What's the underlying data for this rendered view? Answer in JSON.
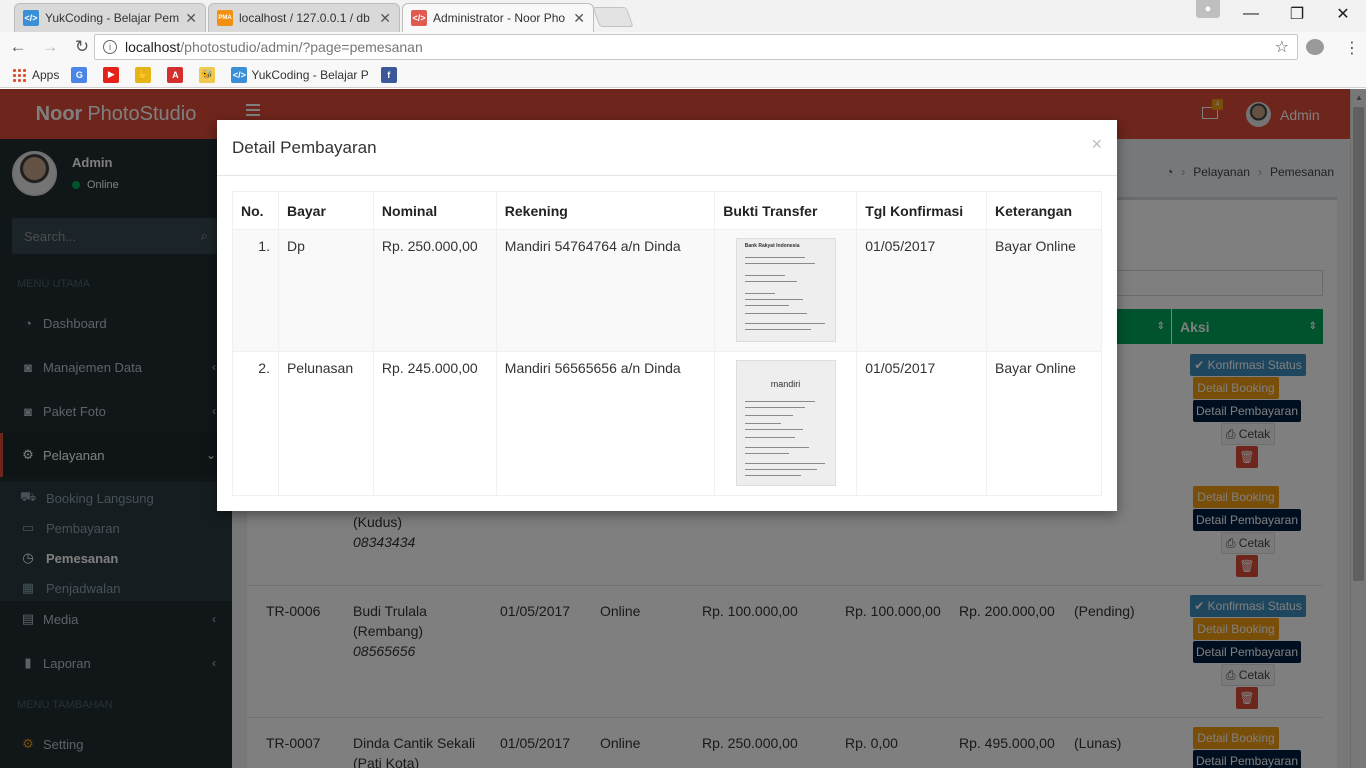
{
  "browser": {
    "tabs": [
      {
        "title": "YukCoding - Belajar Pem",
        "favicon_color": "#3a8fd6",
        "favicon_label": "</>"
      },
      {
        "title": "localhost / 127.0.0.1 / db",
        "favicon_color": "#f29111",
        "favicon_label": "PMA"
      },
      {
        "title": "Administrator - Noor Pho",
        "favicon_color": "#e05a4f",
        "favicon_label": "</>"
      }
    ],
    "url_host": "localhost",
    "url_path": "/photostudio/admin/?page=pemesanan",
    "bookmarks": {
      "apps": "Apps",
      "yukcoding": "YukCoding - Belajar P"
    }
  },
  "app": {
    "logo_bold": "Noor",
    "logo_rest": "PhotoStudio",
    "user_name": "Admin",
    "user_status": "Online",
    "search_placeholder": "Search...",
    "menu_header_main": "MENU UTAMA",
    "menu_header_extra": "MENU TAMBAHAN",
    "menu": {
      "dashboard": "Dashboard",
      "manajemen_data": "Manajemen Data",
      "paket_foto": "Paket Foto",
      "pelayanan": "Pelayanan",
      "media": "Media",
      "laporan": "Laporan",
      "setting": "Setting"
    },
    "submenu": {
      "booking_langsung": "Booking Langsung",
      "pembayaran": "Pembayaran",
      "pemesanan": "Pemesanan",
      "penjadwalan": "Penjadwalan"
    },
    "nav_user": "Admin",
    "mail_count": "4",
    "breadcrumb": {
      "level1": "Pelayanan",
      "level2": "Pemesanan"
    },
    "table": {
      "header_aksi": "Aksi",
      "rows": [
        {
          "kode": "",
          "nama": "(Kudus)",
          "telp": "08343434",
          "tgl": "",
          "jenis": "",
          "dp": "",
          "sisa": "",
          "total": "",
          "status": ""
        },
        {
          "kode": "TR-0006",
          "nama": "Budi Trulala",
          "kota": "(Rembang)",
          "telp": "08565656",
          "tgl": "01/05/2017",
          "jenis": "Online",
          "dp": "Rp. 100.000,00",
          "sisa": "Rp. 100.000,00",
          "total": "Rp. 200.000,00",
          "status": "(Pending)"
        },
        {
          "kode": "TR-0007",
          "nama": "Dinda Cantik Sekali",
          "kota": "(Pati Kota)",
          "tgl": "01/05/2017",
          "jenis": "Online",
          "dp": "Rp. 250.000,00",
          "sisa": "Rp. 0,00",
          "total": "Rp. 495.000,00",
          "status": "(Lunas)"
        }
      ]
    },
    "actions": {
      "konfirmasi": "Konfirmasi Status",
      "detail_booking": "Detail Booking",
      "detail_pembayaran": "Detail Pembayaran",
      "cetak": "Cetak"
    }
  },
  "modal": {
    "title": "Detail Pembayaran",
    "close": "×",
    "headers": [
      "No.",
      "Bayar",
      "Nominal",
      "Rekening",
      "Bukti Transfer",
      "Tgl Konfirmasi",
      "Keterangan"
    ],
    "rows": [
      {
        "no": "1.",
        "bayar": "Dp",
        "nominal": "Rp. 250.000,00",
        "rekening": "Mandiri 54764764 a/n Dinda",
        "bukti": "Bank Rakyat Indonesia",
        "tgl": "01/05/2017",
        "keterangan": "Bayar Online"
      },
      {
        "no": "2.",
        "bayar": "Pelunasan",
        "nominal": "Rp. 245.000,00",
        "rekening": "Mandiri 56565656 a/n Dinda",
        "bukti": "mandiri",
        "tgl": "01/05/2017",
        "keterangan": "Bayar Online"
      }
    ]
  }
}
